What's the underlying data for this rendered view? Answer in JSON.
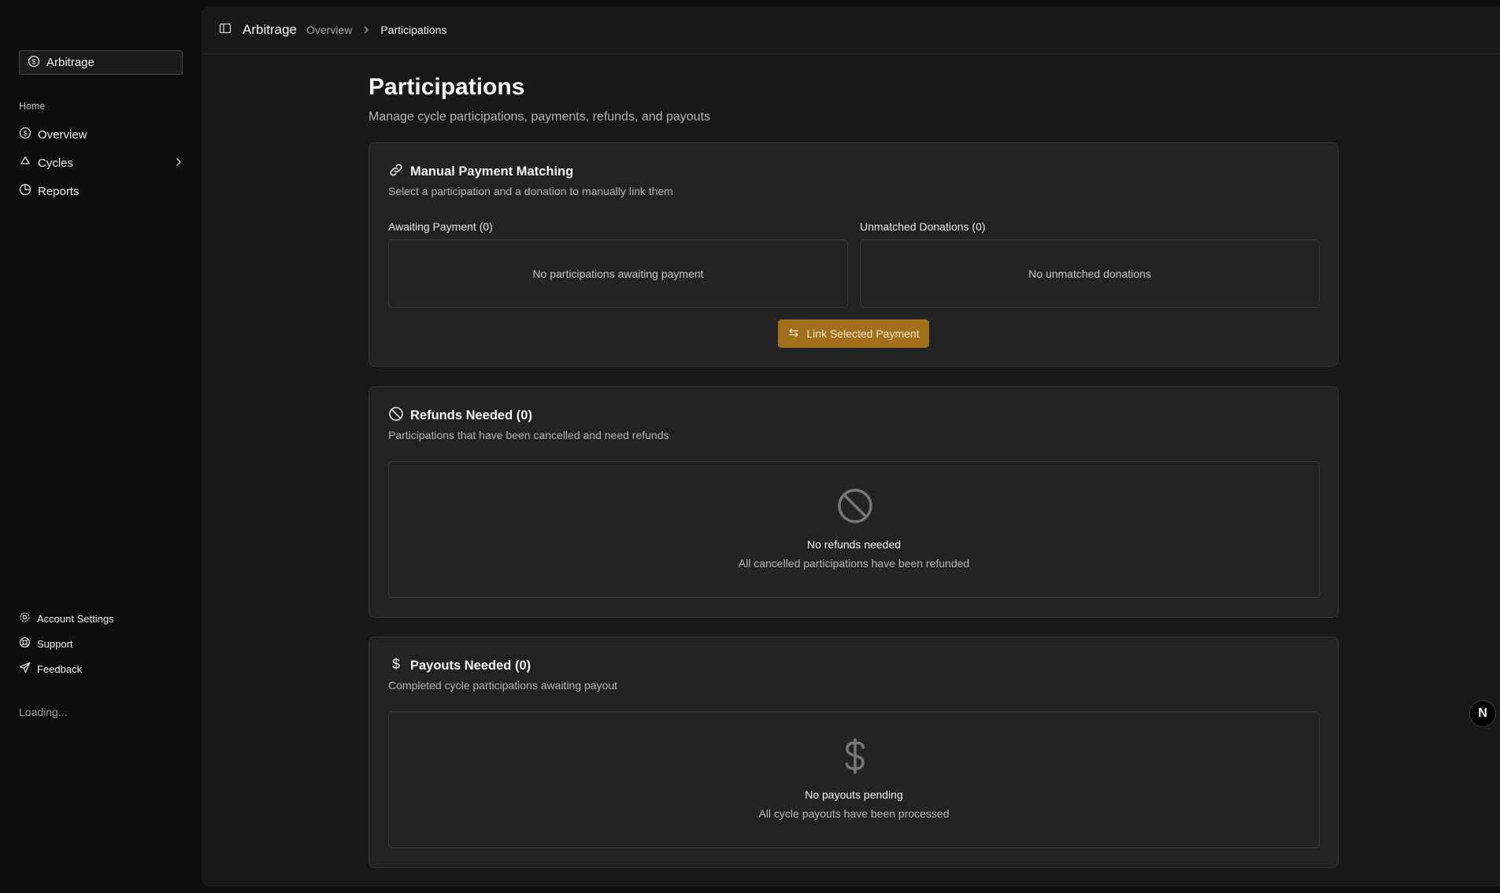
{
  "sidebar": {
    "team": "Arbitrage",
    "group_label": "Home",
    "items": [
      {
        "label": "Overview"
      },
      {
        "label": "Cycles"
      },
      {
        "label": "Reports"
      }
    ],
    "bottom_items": [
      {
        "label": "Account Settings"
      },
      {
        "label": "Support"
      },
      {
        "label": "Feedback"
      }
    ],
    "status": "Loading..."
  },
  "header": {
    "app_name": "Arbitrage",
    "breadcrumb": [
      "Overview",
      "Participations"
    ]
  },
  "page": {
    "title": "Participations",
    "subtitle": "Manage cycle participations, payments, refunds, and payouts"
  },
  "matching": {
    "title": "Manual Payment Matching",
    "description": "Select a participation and a donation to manually link them",
    "awaiting_label": "Awaiting Payment (0)",
    "awaiting_empty": "No participations awaiting payment",
    "unmatched_label": "Unmatched Donations (0)",
    "unmatched_empty": "No unmatched donations",
    "button_label": "Link Selected Payment"
  },
  "refunds": {
    "title": "Refunds Needed (0)",
    "description": "Participations that have been cancelled and need refunds",
    "empty_title": "No refunds needed",
    "empty_desc": "All cancelled participations have been refunded"
  },
  "payouts": {
    "title": "Payouts Needed (0)",
    "description": "Completed cycle participations awaiting payout",
    "empty_title": "No payouts pending",
    "empty_desc": "All cycle payouts have been processed"
  },
  "badge": "N",
  "colors": {
    "accent_button": "#a0701c",
    "background": "#0e0e0e",
    "panel": "#181818",
    "card": "#222222"
  }
}
